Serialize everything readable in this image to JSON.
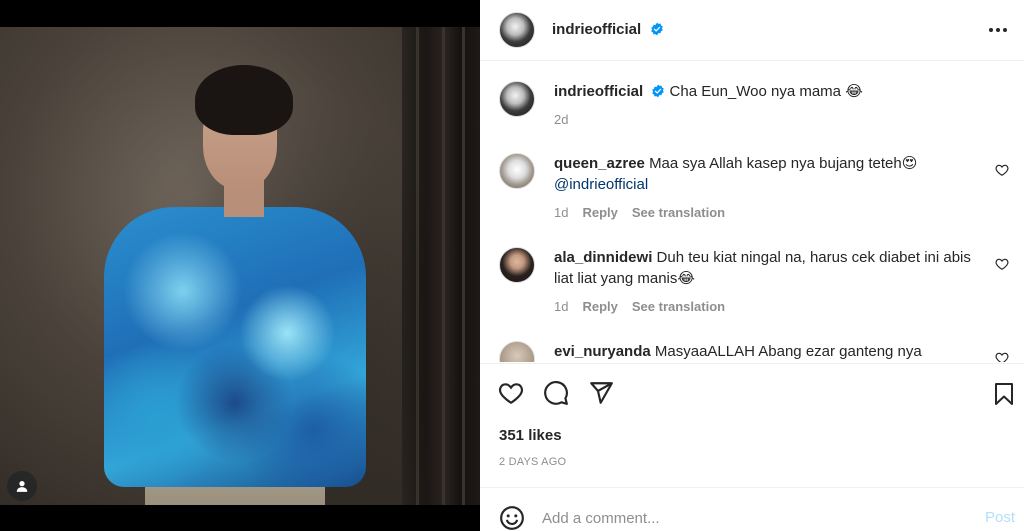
{
  "post": {
    "username": "indrieofficial",
    "caption": "Cha Eun_Woo nya mama",
    "caption_emoji": "😂",
    "time_short": "2d"
  },
  "comments": [
    {
      "username": "queen_azree",
      "text": "Maa sya Allah kasep nya bujang teteh",
      "emoji": "😍",
      "mention": "@indrieofficial",
      "time": "1d",
      "reply": "Reply",
      "translate": "See translation"
    },
    {
      "username": "ala_dinnidewi",
      "text": "Duh teu kiat ningal na, harus cek diabet ini abis liat liat yang manis",
      "emoji": "😂",
      "time": "1d",
      "reply": "Reply",
      "translate": "See translation"
    },
    {
      "username": "evi_nuryanda",
      "text": "MasyaaALLAH Abang ezar ganteng nya"
    }
  ],
  "actions": {
    "likes": "351 likes",
    "timestamp": "2 DAYS AGO"
  },
  "add_comment": {
    "placeholder": "Add a comment...",
    "post_label": "Post"
  },
  "icons": {
    "header_more": "more-horizontal-icon",
    "verified": "verified-badge-icon",
    "like": "heart-icon",
    "comment": "comment-icon",
    "share": "share-icon",
    "save": "bookmark-icon",
    "emoji": "emoji-icon",
    "user_tag": "user-tag-icon"
  },
  "colors": {
    "verified": "#0095f6",
    "link": "#00376b",
    "post_disabled": "#b2dffc",
    "muted": "#8e8e8e"
  }
}
